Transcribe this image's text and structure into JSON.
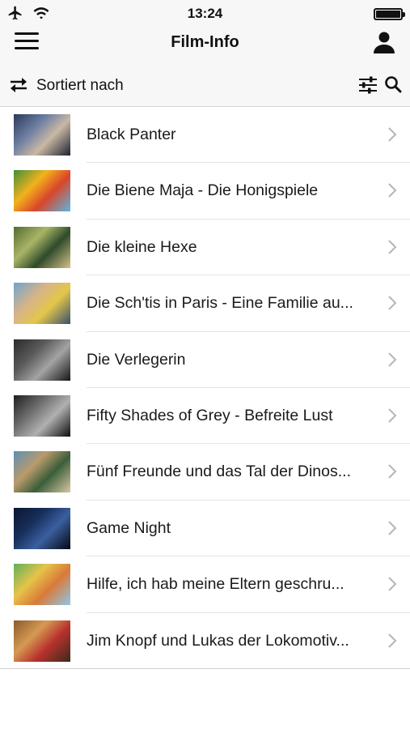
{
  "status_bar": {
    "time": "13:24",
    "icons": [
      "airplane-icon",
      "wifi-icon",
      "battery-icon"
    ]
  },
  "nav": {
    "title": "Film-Info",
    "left_icon": "hamburger-menu-icon",
    "right_icon": "user-icon"
  },
  "sort_bar": {
    "label": "Sortiert nach",
    "icons": [
      "sort-swap-icon",
      "filter-sliders-icon",
      "search-icon"
    ]
  },
  "movies": [
    {
      "title": "Black Panter",
      "thumb_colors": [
        "#2b3a5a",
        "#6d7fa3",
        "#c9b8a4",
        "#1c2230"
      ]
    },
    {
      "title": "Die Biene Maja - Die Honigspiele",
      "thumb_colors": [
        "#3f8f3a",
        "#f2b21c",
        "#d9452b",
        "#5bb6e0"
      ]
    },
    {
      "title": "Die kleine Hexe",
      "thumb_colors": [
        "#556b2f",
        "#a8b567",
        "#2f4a2a",
        "#d6c089"
      ]
    },
    {
      "title": "Die Sch'tis in Paris - Eine Familie au...",
      "thumb_colors": [
        "#6fa4cf",
        "#d6b38a",
        "#e3c74a",
        "#384f6b"
      ]
    },
    {
      "title": "Die Verlegerin",
      "thumb_colors": [
        "#2a2a2a",
        "#5b5b5b",
        "#a3a3a3",
        "#151515"
      ]
    },
    {
      "title": "Fifty Shades of Grey - Befreite Lust",
      "thumb_colors": [
        "#1f1f1f",
        "#6e6e6e",
        "#b0b0b0",
        "#0e0e0e"
      ]
    },
    {
      "title": "Fünf Freunde und das Tal der Dinos...",
      "thumb_colors": [
        "#5d8fb8",
        "#b99a6b",
        "#3b5e3a",
        "#d9c7a2"
      ]
    },
    {
      "title": "Game Night",
      "thumb_colors": [
        "#0b1530",
        "#18305c",
        "#3a5fa0",
        "#05080f"
      ]
    },
    {
      "title": "Hilfe, ich hab meine Eltern geschru...",
      "thumb_colors": [
        "#5fb05b",
        "#e6c34a",
        "#d97a39",
        "#8fc6e8"
      ]
    },
    {
      "title": "Jim Knopf und Lukas der Lokomotiv...",
      "thumb_colors": [
        "#8a5a2b",
        "#d59a52",
        "#b8322d",
        "#3c2a1a"
      ]
    }
  ]
}
